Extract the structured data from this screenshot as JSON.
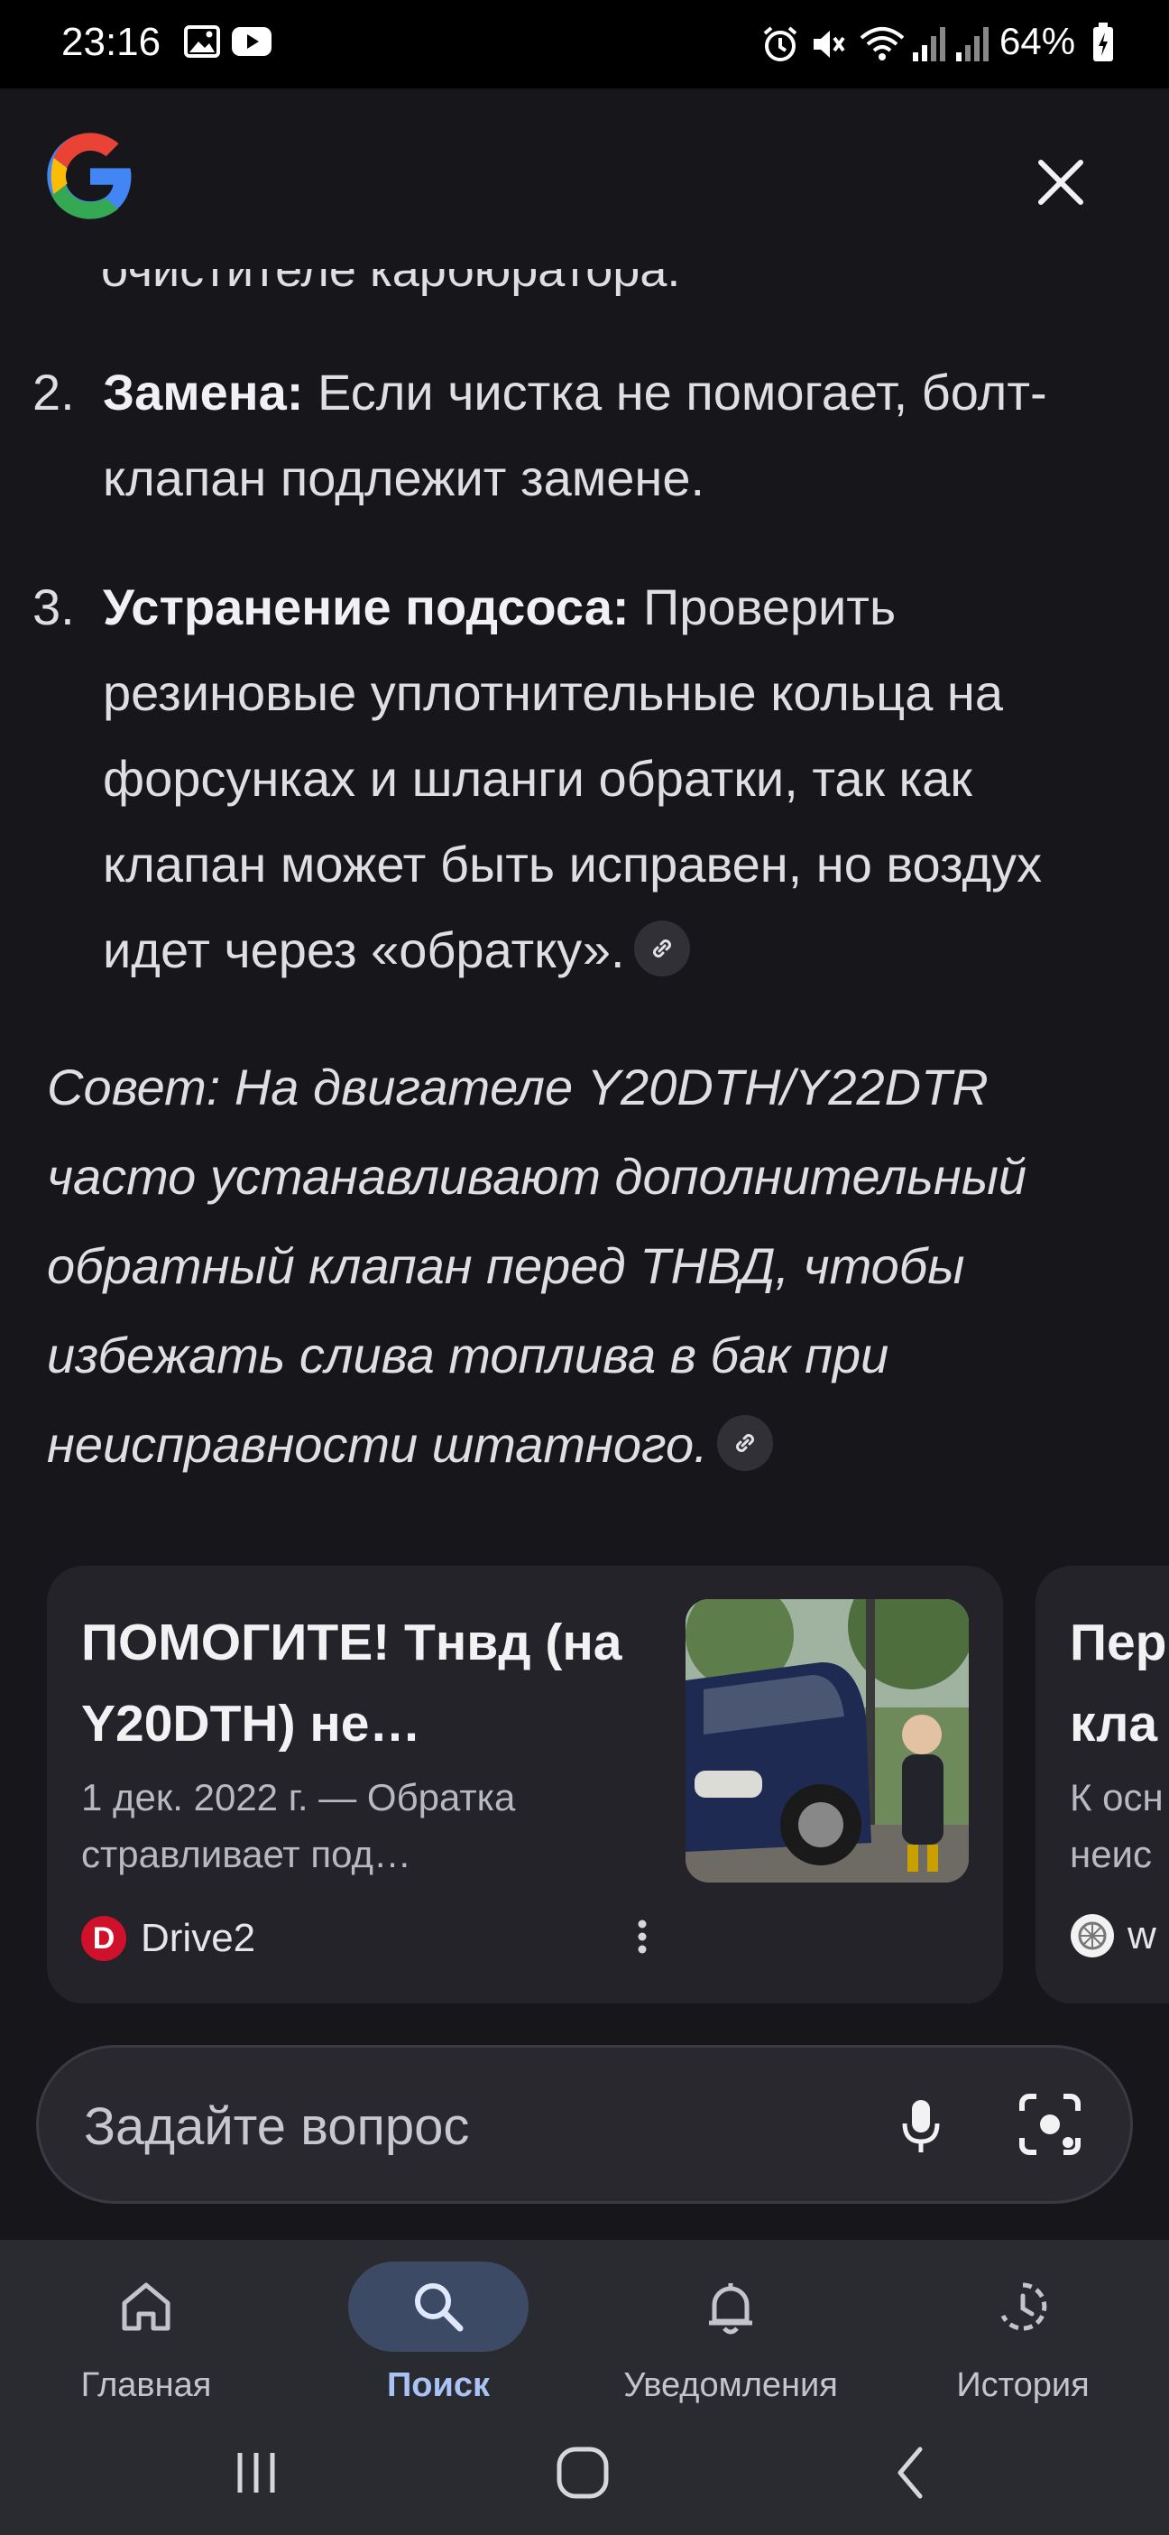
{
  "status_bar": {
    "time": "23:16",
    "battery": "64%",
    "left_icons": [
      "image-icon",
      "youtube-icon"
    ],
    "right_icons": [
      "alarm-icon",
      "mute-icon",
      "wifi-icon",
      "signal-icon",
      "signal-icon",
      "battery-icon"
    ]
  },
  "header": {
    "logo": "google-g-logo",
    "close_icon": "close-icon"
  },
  "answer": {
    "clipped_line": "очистителе карбюратора.",
    "items": [
      {
        "number": "2.",
        "bold": "Замена:",
        "text": " Если чистка не помогает, болт-клапан подлежит замене."
      },
      {
        "number": "3.",
        "bold": "Устранение подсоса:",
        "text": " Проверить резиновые уплотнительные кольца на форсунках и шланги обратки, так как клапан может быть исправен, но воздух идет через «обратку».",
        "link_icon": "link-icon"
      }
    ],
    "tip": "Совет: На двигателе Y20DTH/Y22DTR часто устанавливают дополнительный обратный клапан перед ТНВД, чтобы избежать слива топлива в бак при неисправности штатного.",
    "tip_link_icon": "link-icon"
  },
  "cards": [
    {
      "title": "ПОМОГИТЕ! Тнвд (на Y20DTH) не…",
      "description": "1 дек. 2022 г. — Обратка стравливает под…",
      "source": "Drive2",
      "source_favicon_letter": "D",
      "more_icon": "more-vert-icon"
    },
    {
      "title_line1": "Пер",
      "title_line2": "кла",
      "desc_line1": "К осн",
      "desc_line2": "неис",
      "source": "w"
    }
  ],
  "ask": {
    "placeholder": "Задайте вопрос",
    "mic_icon": "mic-icon",
    "lens_icon": "lens-icon"
  },
  "bottom_nav": {
    "items": [
      {
        "label": "Главная",
        "icon": "home-icon",
        "active": false
      },
      {
        "label": "Поиск",
        "icon": "search-icon",
        "active": true
      },
      {
        "label": "Уведомления",
        "icon": "bell-icon",
        "active": false
      },
      {
        "label": "История",
        "icon": "history-icon",
        "active": false
      }
    ]
  },
  "system_nav": [
    "recents-icon",
    "home-circle-icon",
    "back-icon"
  ],
  "colors": {
    "background": "#16161b",
    "card": "#232329",
    "nav_active_pill": "#3d4a66",
    "nav_active_label": "#a9c3f5",
    "drive2_red": "#d0112b"
  }
}
